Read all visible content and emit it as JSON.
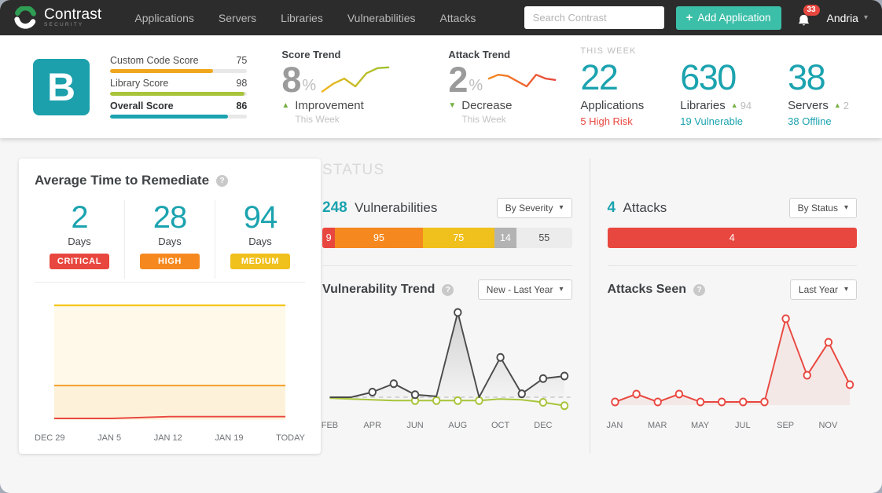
{
  "icons": {
    "plus": "+",
    "caret_down": "▾",
    "help": "?",
    "triangle_up": "▲",
    "triangle_down": "▼"
  },
  "nav": {
    "brand": "Contrast",
    "brand_sub": "SECURITY",
    "items": [
      "Applications",
      "Servers",
      "Libraries",
      "Vulnerabilities",
      "Attacks"
    ],
    "search_placeholder": "Search Contrast",
    "add_button_label": "Add Application",
    "notification_count": "33",
    "user_name": "Andria"
  },
  "scorecard": {
    "grade": "B",
    "scores": [
      {
        "label": "Custom Code Score",
        "value": 75,
        "color": "#f0a71c",
        "bold": false
      },
      {
        "label": "Library Score",
        "value": 98,
        "color": "#a8c43a",
        "bold": false
      },
      {
        "label": "Overall Score",
        "value": 86,
        "color": "#1ba3af",
        "bold": true
      }
    ],
    "score_trend": {
      "title": "Score Trend",
      "pct": "8",
      "pct_unit": "%",
      "direction": "Improvement",
      "period": "This Week",
      "spark": [
        1,
        4,
        6,
        3,
        8,
        10,
        10.3
      ],
      "spark_colors": [
        "#f0b41c",
        "#9dc22e"
      ]
    },
    "attack_trend": {
      "title": "Attack Trend",
      "pct": "2",
      "pct_unit": "%",
      "direction": "Decrease",
      "period": "This Week",
      "spark": [
        6,
        7.5,
        7,
        5,
        3,
        7.5,
        6,
        5.5
      ],
      "spark_colors": [
        "#f5891f",
        "#e8473f"
      ]
    },
    "this_week": {
      "label": "THIS WEEK",
      "stats": [
        {
          "value": "22",
          "label": "Applications",
          "delta": null,
          "sub": "5 High Risk",
          "sub_color": "#e8473f"
        },
        {
          "value": "630",
          "label": "Libraries",
          "delta": "94",
          "sub": "19 Vulnerable",
          "sub_color": "#1ba3af"
        },
        {
          "value": "38",
          "label": "Servers",
          "delta": "2",
          "sub": "38 Offline",
          "sub_color": "#1ba3af"
        }
      ]
    }
  },
  "remediate": {
    "title": "Average Time to Remediate",
    "stats": [
      {
        "value": "2",
        "unit": "Days",
        "badge": "CRITICAL",
        "color": "#e8473f"
      },
      {
        "value": "28",
        "unit": "Days",
        "badge": "HIGH",
        "color": "#f5891f"
      },
      {
        "value": "94",
        "unit": "Days",
        "badge": "MEDIUM",
        "color": "#f0c01d"
      }
    ],
    "chart": {
      "type": "line",
      "x_labels": [
        "DEC 29",
        "JAN 5",
        "JAN 12",
        "JAN 19",
        "TODAY"
      ],
      "ylim": [
        0,
        100
      ],
      "series": [
        {
          "name": "medium",
          "color": "#f5c71e",
          "values": [
            94,
            94,
            94,
            94,
            94
          ]
        },
        {
          "name": "high",
          "color": "#f5981f",
          "values": [
            28,
            28,
            28,
            28,
            28
          ]
        },
        {
          "name": "critical",
          "color": "#e8473f",
          "values": [
            1,
            1,
            2.5,
            2.5,
            2.5
          ]
        }
      ]
    }
  },
  "status": {
    "heading": "STATUS",
    "vulnerabilities": {
      "count": "248",
      "label": "Vulnerabilities",
      "filter": "By Severity",
      "segments": [
        {
          "value": 9,
          "color": "#e8473f",
          "text_color": "#ffffff"
        },
        {
          "value": 95,
          "color": "#f5891f",
          "text_color": "#ffffff"
        },
        {
          "value": 75,
          "color": "#f0c01d",
          "text_color": "#ffffff"
        },
        {
          "value": 14,
          "color": "#b3b3b3",
          "text_color": "#ffffff"
        },
        {
          "value": 55,
          "color": "#ececec",
          "text_color": "#4a4a4a"
        }
      ]
    },
    "vuln_trend": {
      "title": "Vulnerability Trend",
      "filter": "New - Last Year",
      "type": "line",
      "x_labels": [
        "FEB",
        "APR",
        "JUN",
        "AUG",
        "OCT",
        "DEC"
      ],
      "ylim": [
        -14,
        100
      ],
      "series": [
        {
          "name": "new",
          "color": "#4b4b4b",
          "values": [
            0,
            0,
            6,
            16,
            3,
            1,
            100,
            0,
            47,
            4,
            22,
            25
          ],
          "markers": [
            2,
            3,
            4,
            6,
            8,
            9,
            10,
            11
          ]
        },
        {
          "name": "remediated",
          "color": "#a8c43a",
          "values": [
            -1,
            -2,
            -3,
            -4,
            -4,
            -4,
            -4,
            -4,
            -2,
            -3,
            -6,
            -10
          ],
          "markers": [
            4,
            5,
            6,
            7,
            10,
            11
          ]
        }
      ]
    },
    "attacks": {
      "count": "4",
      "label": "Attacks",
      "filter": "By Status",
      "bar_value": "4",
      "bar_color": "#e8473f"
    },
    "attacks_seen": {
      "title": "Attacks Seen",
      "filter": "Last Year",
      "type": "line",
      "x_labels": [
        "JAN",
        "MAR",
        "MAY",
        "JUL",
        "SEP",
        "NOV"
      ],
      "ylim": [
        0,
        55
      ],
      "series": [
        {
          "name": "attacks",
          "color": "#e8473f",
          "values": [
            2,
            7,
            2,
            7,
            2,
            2,
            2,
            2,
            55,
            19,
            40,
            13
          ]
        }
      ]
    }
  }
}
